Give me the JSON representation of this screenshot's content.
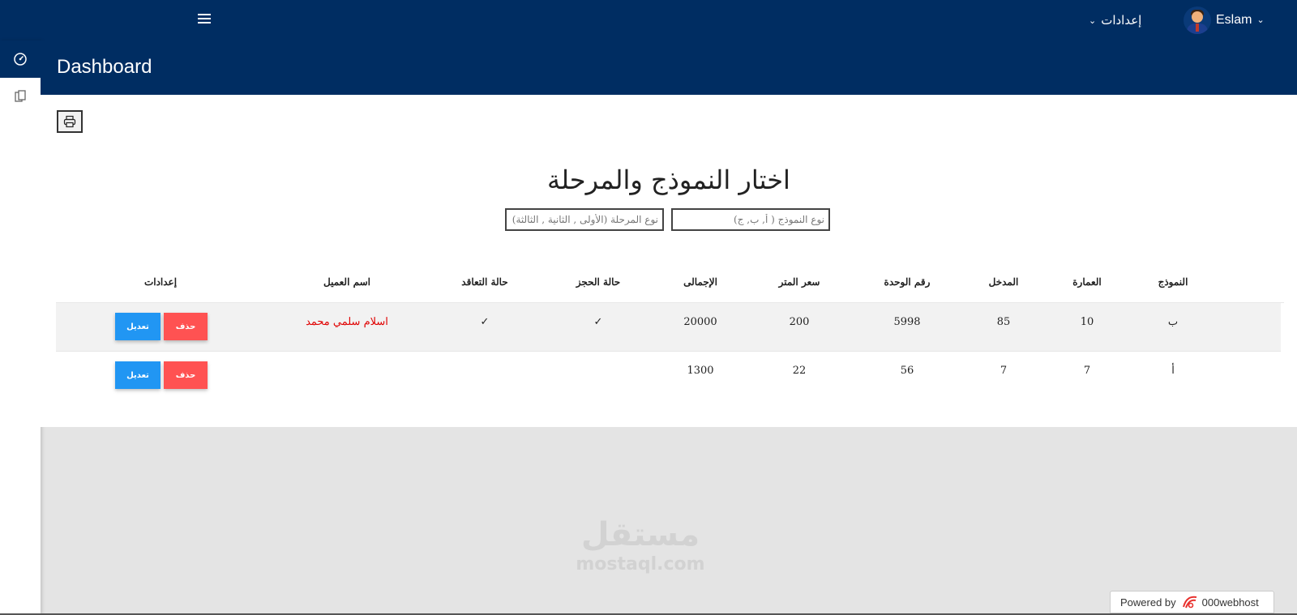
{
  "header": {
    "settings_label": "إعدادات",
    "user_name": "Eslam"
  },
  "page": {
    "title": "Dashboard"
  },
  "main": {
    "heading": "اختار النموذج والمرحلة",
    "model_filter_placeholder": "نوع النموذج ( أ, ب, ج)",
    "phase_filter_placeholder": "نوع المرحلة (الأولى , الثانية , الثالثة)"
  },
  "table": {
    "columns": [
      "النموذج",
      "العمارة",
      "المدخل",
      "رقم الوحدة",
      "سعر المتر",
      "الإجمالى",
      "حالة الحجز",
      "حالة التعاقد",
      "اسم العميل",
      "إعدادات"
    ],
    "rows": [
      {
        "model": "ب",
        "building": "10",
        "entrance": "85",
        "unit_no": "5998",
        "meter_price": "200",
        "total": "20000",
        "booking_status": "✓",
        "contract_status": "✓",
        "client_name": "اسلام سلمي محمد",
        "delete_label": "حذف",
        "edit_label": "تعديل"
      },
      {
        "model": "أ",
        "building": "7",
        "entrance": "7",
        "unit_no": "56",
        "meter_price": "22",
        "total": "1300",
        "booking_status": "",
        "contract_status": "",
        "client_name": "",
        "delete_label": "حذف",
        "edit_label": "تعديل"
      }
    ]
  },
  "watermark": {
    "arabic": "مستقل",
    "latin": "mostaql.com"
  },
  "footer": {
    "powered_by": "Powered by",
    "host_name": "000webhost"
  },
  "colors": {
    "navy": "#002d62",
    "delete_red": "#ff5252",
    "edit_blue": "#2196f3",
    "client_red": "#e00000"
  },
  "icons": {
    "menu": "hamburger-icon",
    "dashboard": "speedometer-icon",
    "documents": "copy-icon",
    "print": "printer-icon"
  }
}
